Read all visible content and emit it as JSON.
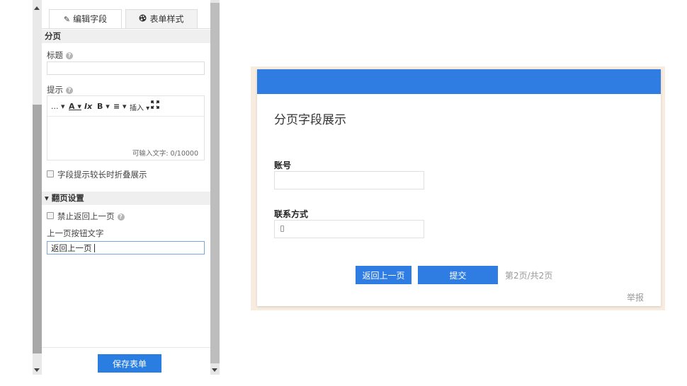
{
  "editor": {
    "tabs": [
      {
        "label": "编辑字段",
        "icon": "pencil-icon"
      },
      {
        "label": "表单样式",
        "icon": "palette-icon"
      }
    ],
    "section_page": "分页",
    "title_label": "标题",
    "title_value": "",
    "hint_label": "提示",
    "toolbar": {
      "more": "...",
      "font_color": "A",
      "clear_format": "Ix",
      "bold": "B",
      "align": "≡",
      "insert": "插入",
      "fullscreen_icon": "fullscreen-icon"
    },
    "char_count": "可输入文字: 0/10000",
    "collapse_hint_label": "字段提示较长时折叠展示",
    "section_paging": "翻页设置",
    "disable_back_label": "禁止返回上一页",
    "prev_button_text_label": "上一页按钮文字",
    "prev_button_text_value": "返回上一页",
    "save_button": "保存表单"
  },
  "preview": {
    "banner_color": "#2f7de2",
    "form_title": "分页字段展示",
    "fields": [
      {
        "label": "账号",
        "value": ""
      },
      {
        "label": "联系方式",
        "value": ""
      }
    ],
    "prev_button": "返回上一页",
    "submit_button": "提交",
    "page_indicator": "第2页/共2页",
    "report": "举报"
  }
}
